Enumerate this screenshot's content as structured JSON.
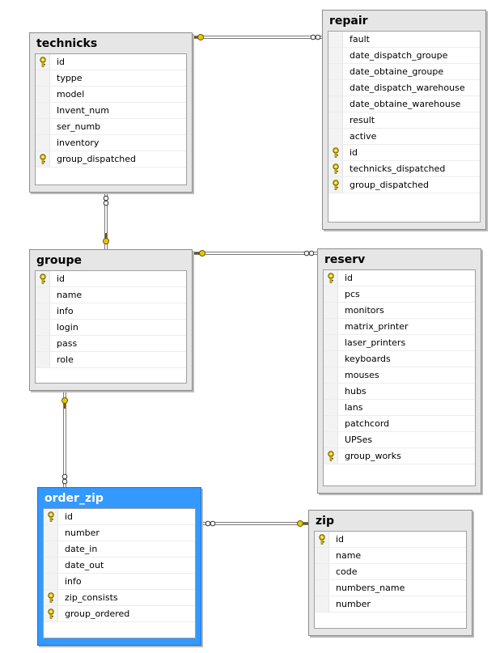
{
  "tables": [
    {
      "id": "technicks",
      "title": "technicks",
      "selected": false,
      "columns": [
        {
          "name": "id",
          "pk": true
        },
        {
          "name": "typpe",
          "pk": false
        },
        {
          "name": "model",
          "pk": false
        },
        {
          "name": "Invent_num",
          "pk": false
        },
        {
          "name": "ser_numb",
          "pk": false
        },
        {
          "name": "inventory",
          "pk": false
        },
        {
          "name": "group_dispatched",
          "pk": true
        }
      ]
    },
    {
      "id": "repair",
      "title": "repair",
      "selected": false,
      "columns": [
        {
          "name": "fault",
          "pk": false
        },
        {
          "name": "date_dispatch_groupe",
          "pk": false
        },
        {
          "name": "date_obtaine_groupe",
          "pk": false
        },
        {
          "name": "date_dispatch_warehouse",
          "pk": false
        },
        {
          "name": "date_obtaine_warehouse",
          "pk": false
        },
        {
          "name": "result",
          "pk": false
        },
        {
          "name": "active",
          "pk": false
        },
        {
          "name": "id",
          "pk": true
        },
        {
          "name": "technicks_dispatched",
          "pk": true
        },
        {
          "name": "group_dispatched",
          "pk": true
        }
      ]
    },
    {
      "id": "groupe",
      "title": "groupe",
      "selected": false,
      "columns": [
        {
          "name": "id",
          "pk": true
        },
        {
          "name": "name",
          "pk": false
        },
        {
          "name": "info",
          "pk": false
        },
        {
          "name": "login",
          "pk": false
        },
        {
          "name": "pass",
          "pk": false
        },
        {
          "name": "role",
          "pk": false
        }
      ]
    },
    {
      "id": "reserv",
      "title": "reserv",
      "selected": false,
      "columns": [
        {
          "name": "id",
          "pk": true
        },
        {
          "name": "pcs",
          "pk": false
        },
        {
          "name": "monitors",
          "pk": false
        },
        {
          "name": "matrix_printer",
          "pk": false
        },
        {
          "name": "laser_printers",
          "pk": false
        },
        {
          "name": "keyboards",
          "pk": false
        },
        {
          "name": "mouses",
          "pk": false
        },
        {
          "name": "hubs",
          "pk": false
        },
        {
          "name": "lans",
          "pk": false
        },
        {
          "name": "patchcord",
          "pk": false
        },
        {
          "name": "UPSes",
          "pk": false
        },
        {
          "name": "group_works",
          "pk": true
        }
      ]
    },
    {
      "id": "order_zip",
      "title": "order_zip",
      "selected": true,
      "columns": [
        {
          "name": "id",
          "pk": true
        },
        {
          "name": "number",
          "pk": false
        },
        {
          "name": "date_in",
          "pk": false
        },
        {
          "name": "date_out",
          "pk": false
        },
        {
          "name": "info",
          "pk": false
        },
        {
          "name": "zip_consists",
          "pk": true
        },
        {
          "name": "group_ordered",
          "pk": true
        }
      ]
    },
    {
      "id": "zip",
      "title": "zip",
      "selected": false,
      "columns": [
        {
          "name": "id",
          "pk": true
        },
        {
          "name": "name",
          "pk": false
        },
        {
          "name": "code",
          "pk": false
        },
        {
          "name": "numbers_name",
          "pk": false
        },
        {
          "name": "number",
          "pk": false
        }
      ]
    }
  ],
  "relationships": [
    {
      "from": "technicks",
      "to": "repair",
      "one_end": "technicks",
      "many_end": "repair"
    },
    {
      "from": "technicks",
      "to": "groupe",
      "one_end": "groupe",
      "many_end": "technicks"
    },
    {
      "from": "groupe",
      "to": "reserv",
      "one_end": "groupe",
      "many_end": "reserv"
    },
    {
      "from": "groupe",
      "to": "order_zip",
      "one_end": "groupe",
      "many_end": "order_zip"
    },
    {
      "from": "order_zip",
      "to": "zip",
      "one_end": "zip",
      "many_end": "order_zip"
    }
  ],
  "colors": {
    "selected_header": "#3399ff",
    "panel": "#e6e6e6",
    "key": "#e8c800",
    "line": "#7a7a7a"
  }
}
